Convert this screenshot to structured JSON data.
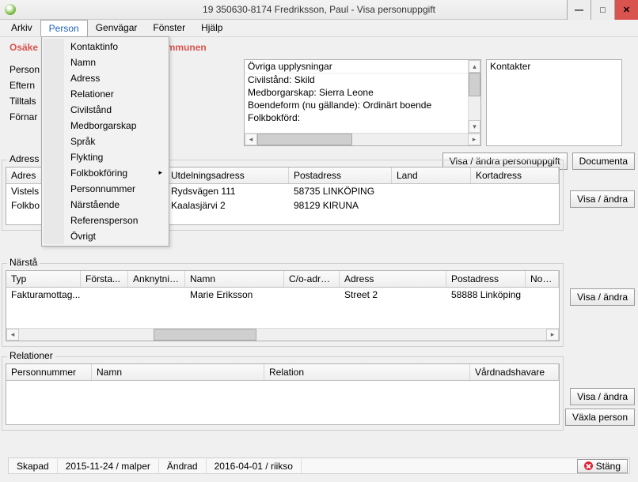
{
  "window": {
    "title": "19 350630-8174   Fredriksson, Paul   -   Visa personuppgift"
  },
  "menubar": [
    "Arkiv",
    "Person",
    "Genvägar",
    "Fönster",
    "Hjälp"
  ],
  "person_menu": [
    {
      "label": "Kontaktinfo"
    },
    {
      "label": "Namn"
    },
    {
      "label": "Adress"
    },
    {
      "label": "Relationer"
    },
    {
      "label": "Civilstånd"
    },
    {
      "label": "Medborgarskap"
    },
    {
      "label": "Språk"
    },
    {
      "label": "Flykting"
    },
    {
      "label": "Folkbokföring",
      "submenu": true
    },
    {
      "label": "Personnummer"
    },
    {
      "label": "Närstående"
    },
    {
      "label": "Referensperson"
    },
    {
      "label": "Övrigt"
    }
  ],
  "alert_partial": "Osäke",
  "alert_tail": "mmunen",
  "left_labels": {
    "person": "Person",
    "eftern": "Eftern",
    "tilltals": "Tilltals",
    "fornar": "Förnar"
  },
  "ovriga": {
    "title": "Övriga upplysningar",
    "lines": [
      "Civilstånd: Skild",
      "Medborgarskap: Sierra Leone",
      "Boendeform (nu gällande): Ordinärt boende",
      "Folkbokförd:"
    ]
  },
  "kontakter": {
    "title": "Kontakter"
  },
  "buttons": {
    "visa_andra_person": "Visa / ändra personuppgift",
    "documenta": "Documenta",
    "visa_andra": "Visa / ändra",
    "vaxla_person": "Växla person",
    "close": "Stäng"
  },
  "adresser": {
    "title": "Adress",
    "headers": [
      "Adres",
      "Utdelningsadress",
      "Postadress",
      "Land",
      "Kortadress"
    ],
    "rows": [
      {
        "c0": "Vistels",
        "c1": "Rydsvägen 111",
        "c2": "58735 LINKÖPING",
        "c3": "",
        "c4": ""
      },
      {
        "c0": "Folkbo",
        "c1": "Kaalasjärvi 2",
        "c2": "98129 KIRUNA",
        "c3": "",
        "c4": ""
      }
    ]
  },
  "narsta": {
    "title": "Närstå",
    "headers": [
      "Typ",
      "Första...",
      "Anknytning",
      "Namn",
      "C/o-adress",
      "Adress",
      "Postadress",
      "Noterin"
    ],
    "row": {
      "typ": "Fakturamottag...",
      "namn": "Marie Eriksson",
      "adress": "Street 2",
      "postadress": "58888 Linköping"
    }
  },
  "relationer": {
    "title": "Relationer",
    "headers": [
      "Personnummer",
      "Namn",
      "Relation",
      "Vårdnadshavare"
    ]
  },
  "status": {
    "skapad_label": "Skapad",
    "skapad_value": "2015-11-24 / malper",
    "andrad_label": "Ändrad",
    "andrad_value": "2016-04-01 / riikso"
  }
}
